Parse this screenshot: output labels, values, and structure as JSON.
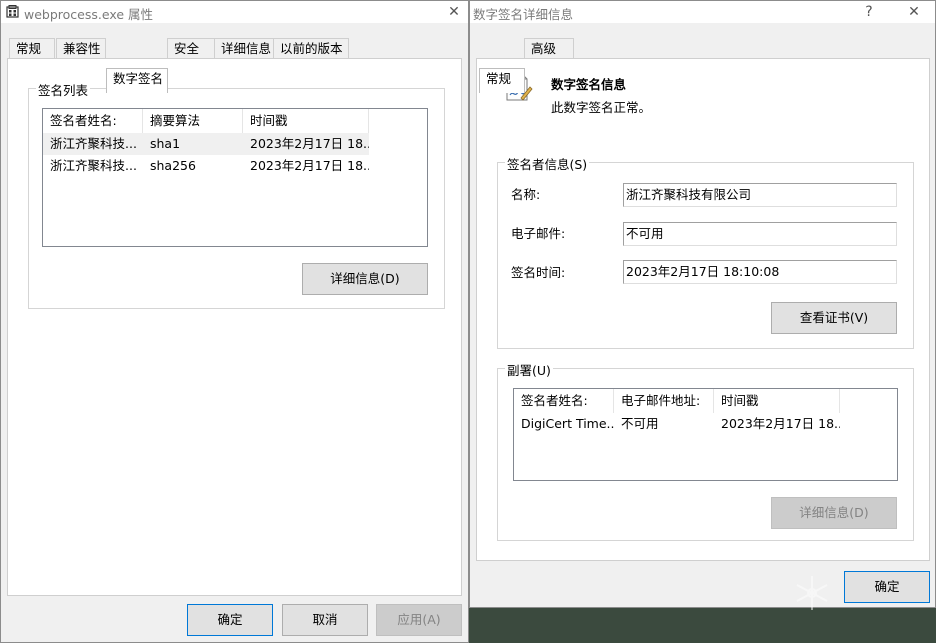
{
  "left_window": {
    "title": "webprocess.exe 属性",
    "close_icon": "close-icon",
    "tabs": [
      {
        "label": "常规"
      },
      {
        "label": "兼容性"
      },
      {
        "label": "数字签名",
        "active": true
      },
      {
        "label": "安全"
      },
      {
        "label": "详细信息"
      },
      {
        "label": "以前的版本"
      }
    ],
    "signature_list": {
      "group_title": "签名列表",
      "columns": [
        "签名者姓名:",
        "摘要算法",
        "时间戳"
      ],
      "rows": [
        {
          "signer": "浙江齐聚科技...",
          "algorithm": "sha1",
          "timestamp": "2023年2月17日 18..."
        },
        {
          "signer": "浙江齐聚科技...",
          "algorithm": "sha256",
          "timestamp": "2023年2月17日 18..."
        }
      ],
      "details_button": "详细信息(D)"
    },
    "buttons": {
      "ok": "确定",
      "cancel": "取消",
      "apply": "应用(A)"
    }
  },
  "right_window": {
    "title": "数字签名详细信息",
    "help_label": "?",
    "tabs": [
      {
        "label": "常规",
        "active": true
      },
      {
        "label": "高级"
      }
    ],
    "info": {
      "heading": "数字签名信息",
      "status": "此数字签名正常。",
      "icon": "certificate-document-icon"
    },
    "signer_info": {
      "group_title": "签名者信息(S)",
      "name_label": "名称:",
      "name_value": "浙江齐聚科技有限公司",
      "email_label": "电子邮件:",
      "email_value": "不可用",
      "time_label": "签名时间:",
      "time_value": "2023年2月17日 18:10:08",
      "view_cert_button": "查看证书(V)"
    },
    "countersignatures": {
      "group_title": "副署(U)",
      "columns": [
        "签名者姓名:",
        "电子邮件地址:",
        "时间戳"
      ],
      "rows": [
        {
          "signer": "DigiCert Time...",
          "email": "不可用",
          "timestamp": "2023年2月17日 18..."
        }
      ],
      "details_button": "详细信息(D)"
    },
    "ok_button": "确定"
  },
  "colors": {
    "window_bg": "#f0f0f0",
    "page_bg": "#ffffff",
    "default_button_border": "#0078d7",
    "disabled_text": "#838383",
    "desktop": "#3b4a3e"
  }
}
